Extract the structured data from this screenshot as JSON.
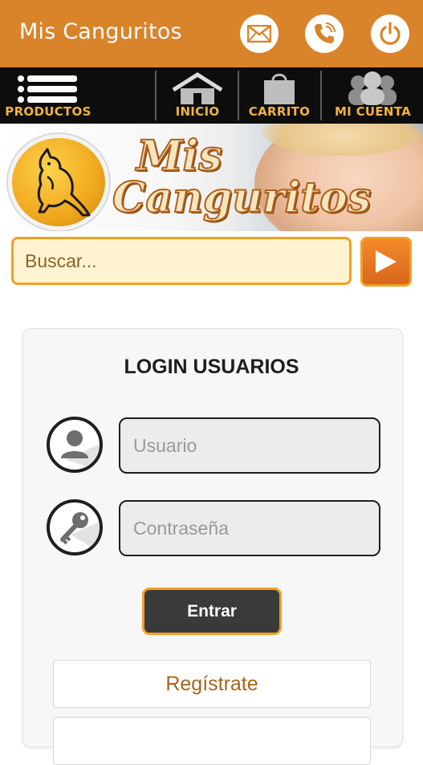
{
  "appbar": {
    "title": "Mis Canguritos",
    "icons": [
      "mail-icon",
      "phone-icon",
      "power-icon"
    ]
  },
  "nav": {
    "items": [
      {
        "label": "PRODUCTOS",
        "icon": "menu-icon"
      },
      {
        "label": "INICIO",
        "icon": "home-icon"
      },
      {
        "label": "CARRITO",
        "icon": "bag-icon"
      },
      {
        "label": "MI CUENTA",
        "icon": "users-icon"
      }
    ]
  },
  "banner": {
    "brand_line1": "Mis",
    "brand_line2": "Canguritos"
  },
  "search": {
    "placeholder": "Buscar...",
    "button_icon": "play-arrow-icon"
  },
  "login": {
    "title": "LOGIN USUARIOS",
    "username_placeholder": "Usuario",
    "password_placeholder": "Contraseña",
    "submit_label": "Entrar",
    "register_label": "Regístrate"
  },
  "colors": {
    "appbar": "#d9832a",
    "navbar": "#0d0d0d",
    "nav_label": "#f1b33c",
    "accent_border": "#f0a024",
    "search_bg": "#fff3d1",
    "button_dark": "#3a3a3a"
  }
}
